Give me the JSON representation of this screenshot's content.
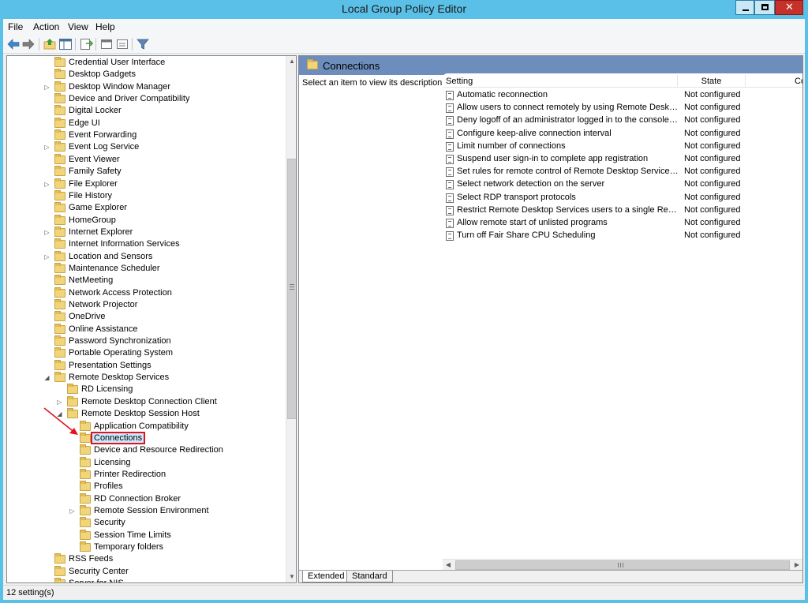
{
  "window": {
    "title": "Local Group Policy Editor",
    "accent_color": "#5bc0e8",
    "controls": {
      "minimize_icon": "minimize-icon",
      "maximize_icon": "maximize-icon",
      "close_icon": "close-icon",
      "close_glyph": "✕"
    }
  },
  "menu": {
    "file": "File",
    "action": "Action",
    "view": "View",
    "help": "Help"
  },
  "toolbar": {
    "buttons": [
      "back-arrow-icon",
      "forward-arrow-icon",
      "up-folder-icon",
      "show-hide-tree-icon",
      "export-list-icon",
      "help-icon",
      "properties-icon",
      "filter-icon"
    ]
  },
  "tree": {
    "items": [
      {
        "label": "Credential User Interface",
        "level": 0,
        "expander": ""
      },
      {
        "label": "Desktop Gadgets",
        "level": 0,
        "expander": ""
      },
      {
        "label": "Desktop Window Manager",
        "level": 0,
        "expander": "▷"
      },
      {
        "label": "Device and Driver Compatibility",
        "level": 0,
        "expander": ""
      },
      {
        "label": "Digital Locker",
        "level": 0,
        "expander": ""
      },
      {
        "label": "Edge UI",
        "level": 0,
        "expander": ""
      },
      {
        "label": "Event Forwarding",
        "level": 0,
        "expander": ""
      },
      {
        "label": "Event Log Service",
        "level": 0,
        "expander": "▷"
      },
      {
        "label": "Event Viewer",
        "level": 0,
        "expander": ""
      },
      {
        "label": "Family Safety",
        "level": 0,
        "expander": ""
      },
      {
        "label": "File Explorer",
        "level": 0,
        "expander": "▷"
      },
      {
        "label": "File History",
        "level": 0,
        "expander": ""
      },
      {
        "label": "Game Explorer",
        "level": 0,
        "expander": ""
      },
      {
        "label": "HomeGroup",
        "level": 0,
        "expander": ""
      },
      {
        "label": "Internet Explorer",
        "level": 0,
        "expander": "▷"
      },
      {
        "label": "Internet Information Services",
        "level": 0,
        "expander": ""
      },
      {
        "label": "Location and Sensors",
        "level": 0,
        "expander": "▷"
      },
      {
        "label": "Maintenance Scheduler",
        "level": 0,
        "expander": ""
      },
      {
        "label": "NetMeeting",
        "level": 0,
        "expander": ""
      },
      {
        "label": "Network Access Protection",
        "level": 0,
        "expander": ""
      },
      {
        "label": "Network Projector",
        "level": 0,
        "expander": ""
      },
      {
        "label": "OneDrive",
        "level": 0,
        "expander": ""
      },
      {
        "label": "Online Assistance",
        "level": 0,
        "expander": ""
      },
      {
        "label": "Password Synchronization",
        "level": 0,
        "expander": ""
      },
      {
        "label": "Portable Operating System",
        "level": 0,
        "expander": ""
      },
      {
        "label": "Presentation Settings",
        "level": 0,
        "expander": ""
      },
      {
        "label": "Remote Desktop Services",
        "level": 0,
        "expander": "◢"
      },
      {
        "label": "RD Licensing",
        "level": 1,
        "expander": ""
      },
      {
        "label": "Remote Desktop Connection Client",
        "level": 1,
        "expander": "▷"
      },
      {
        "label": "Remote Desktop Session Host",
        "level": 1,
        "expander": "◢"
      },
      {
        "label": "Application Compatibility",
        "level": 2,
        "expander": ""
      },
      {
        "label": "Connections",
        "level": 2,
        "expander": "",
        "selected": true
      },
      {
        "label": "Device and Resource Redirection",
        "level": 2,
        "expander": ""
      },
      {
        "label": "Licensing",
        "level": 2,
        "expander": ""
      },
      {
        "label": "Printer Redirection",
        "level": 2,
        "expander": ""
      },
      {
        "label": "Profiles",
        "level": 2,
        "expander": ""
      },
      {
        "label": "RD Connection Broker",
        "level": 2,
        "expander": ""
      },
      {
        "label": "Remote Session Environment",
        "level": 2,
        "expander": "▷"
      },
      {
        "label": "Security",
        "level": 2,
        "expander": ""
      },
      {
        "label": "Session Time Limits",
        "level": 2,
        "expander": ""
      },
      {
        "label": "Temporary folders",
        "level": 2,
        "expander": ""
      },
      {
        "label": "RSS Feeds",
        "level": 0,
        "expander": ""
      },
      {
        "label": "Security Center",
        "level": 0,
        "expander": ""
      },
      {
        "label": "Server for NIS",
        "level": 0,
        "expander": ""
      }
    ]
  },
  "detail": {
    "title": "Connections",
    "description": "Select an item to view its description.",
    "columns": {
      "setting": "Setting",
      "state": "State",
      "comment": "Comment"
    },
    "policies": [
      {
        "setting": "Automatic reconnection",
        "state": "Not configured"
      },
      {
        "setting": "Allow users to connect remotely by using Remote Desktop Services",
        "state": "Not configured"
      },
      {
        "setting": "Deny logoff of an administrator logged in to the console session",
        "state": "Not configured"
      },
      {
        "setting": "Configure keep-alive connection interval",
        "state": "Not configured"
      },
      {
        "setting": "Limit number of connections",
        "state": "Not configured"
      },
      {
        "setting": "Suspend user sign-in to complete app registration",
        "state": "Not configured"
      },
      {
        "setting": "Set rules for remote control of Remote Desktop Services user sessions",
        "state": "Not configured"
      },
      {
        "setting": "Select network detection on the server",
        "state": "Not configured"
      },
      {
        "setting": "Select RDP transport protocols",
        "state": "Not configured"
      },
      {
        "setting": "Restrict Remote Desktop Services users to a single Remote Desktop Services session",
        "state": "Not configured"
      },
      {
        "setting": "Allow remote start of unlisted programs",
        "state": "Not configured"
      },
      {
        "setting": "Turn off Fair Share CPU Scheduling",
        "state": "Not configured"
      }
    ],
    "tabs": {
      "extended": "Extended",
      "standard": "Standard"
    }
  },
  "status": {
    "text": "12 setting(s)"
  },
  "annotation": {
    "arrow_color": "#e0141e",
    "highlight_color": "#e0141e"
  }
}
